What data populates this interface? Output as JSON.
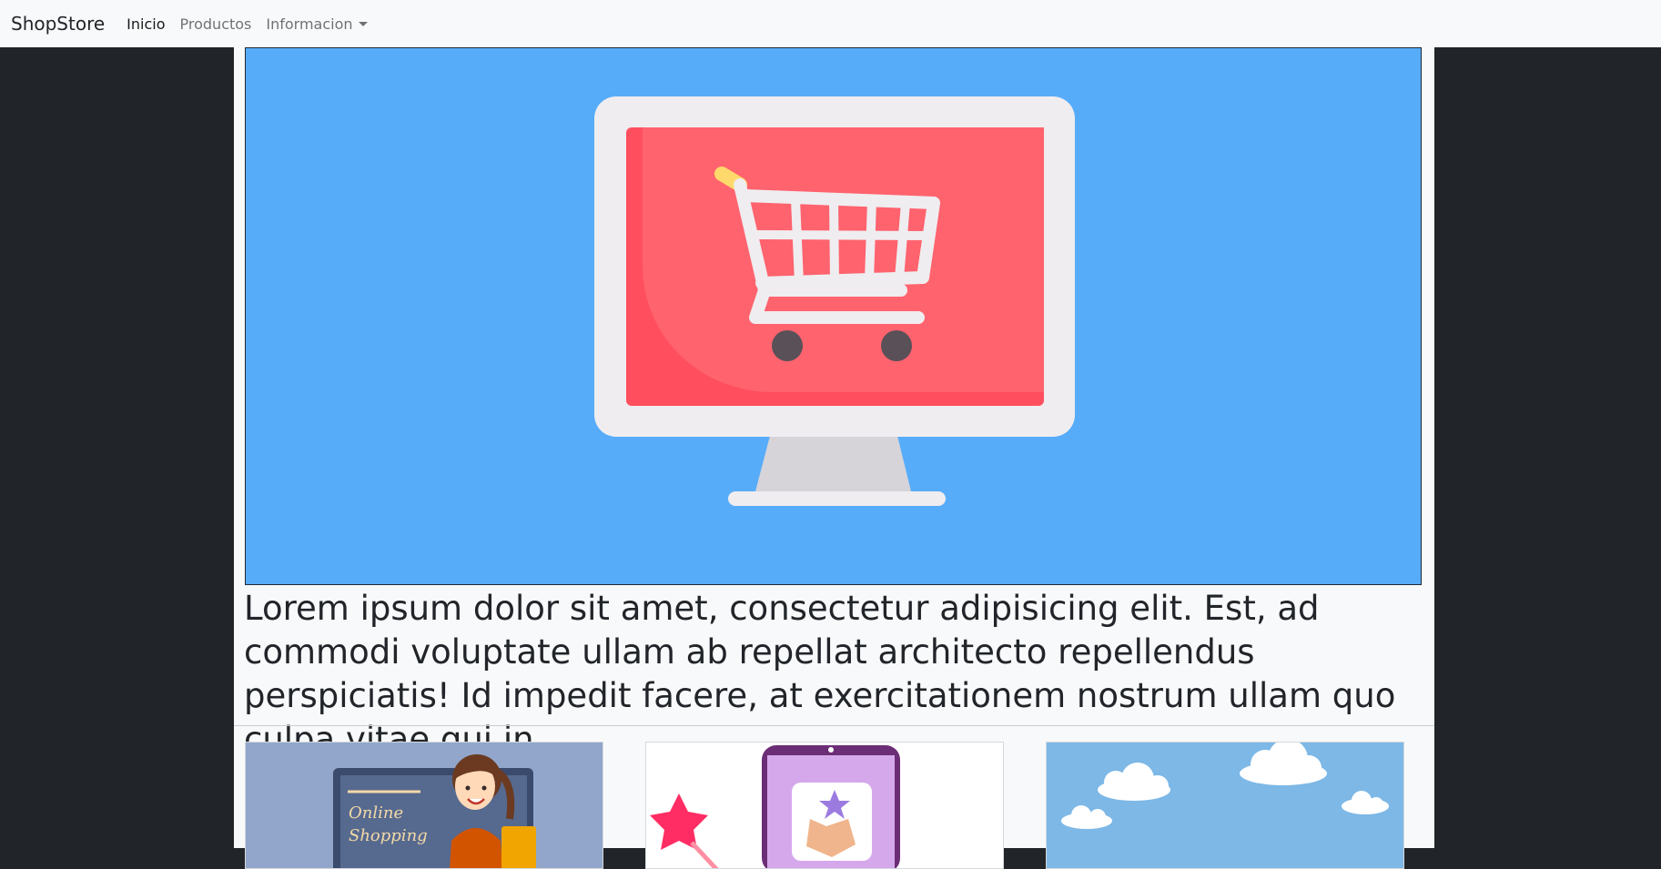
{
  "navbar": {
    "brand": "ShopStore",
    "links": [
      {
        "label": "Inicio",
        "active": true
      },
      {
        "label": "Productos",
        "active": false
      },
      {
        "label": "Informacion",
        "active": false,
        "dropdown": true
      }
    ]
  },
  "hero": {
    "image": "monitor-with-shopping-cart",
    "text": "Lorem ipsum dolor sit amet, consectetur adipisicing elit. Est, ad commodi voluptate ullam ab repellat architecto repellendus perspiciatis! Id impedit facere, at exercitationem nostrum ullam quo culpa vitae qui in."
  },
  "cards": [
    {
      "image": "online-shopping-woman",
      "text": "Online Shopping"
    },
    {
      "image": "phone-star-box"
    },
    {
      "image": "clouds-sky"
    }
  ],
  "colors": {
    "page_bg": "#212529",
    "navbar_bg": "#f8f9fa",
    "hero_bg": "#57acf9",
    "screen_red": "#ff636e",
    "card1_bg": "#92a6cb",
    "card3_bg": "#7db8e6"
  }
}
